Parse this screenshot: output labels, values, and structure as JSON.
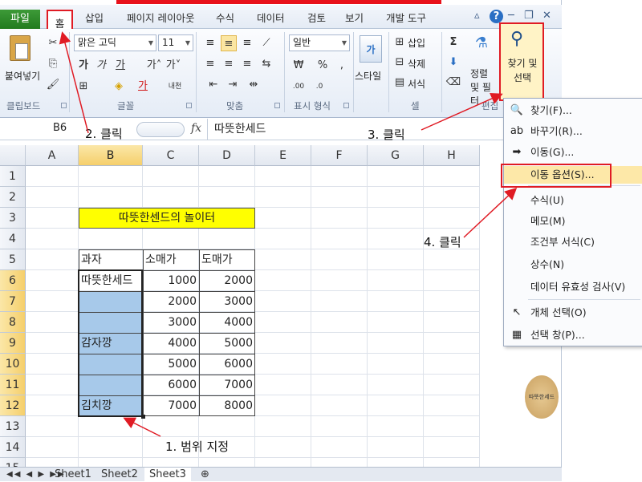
{
  "ribbon_tabs": {
    "file": "파일",
    "home": "홈",
    "insert": "삽입",
    "page_layout": "페이지 레이아웃",
    "formulas": "수식",
    "data": "데이터",
    "review": "검토",
    "view": "보기",
    "developer": "개발 도구"
  },
  "window_controls": {
    "minimize_ribbon": "▵",
    "help": "?",
    "minimize": "─",
    "restore": "❐",
    "close": "✕"
  },
  "ribbon": {
    "paste": "붙여넣기",
    "clipboard_group": "클립보드",
    "font_name": "맑은 고딕",
    "font_size": "11",
    "font_group": "글꼴",
    "align_group": "맞춤",
    "number_format": "일반",
    "number_group": "표시 형식",
    "style": "스타일",
    "insert_cells": "삽입",
    "delete_cells": "삭제",
    "format_cells": "서식",
    "cells_group": "셀",
    "sort_filter": "정렬 및 필터",
    "find_select": "찾기 및 선택",
    "edit_group": "편집"
  },
  "formula_bar": {
    "name_box": "B6",
    "fx": "fx",
    "content": "따뜻한세드"
  },
  "columns": [
    "A",
    "B",
    "C",
    "D",
    "E",
    "F",
    "G",
    "H"
  ],
  "rows": [
    "1",
    "2",
    "3",
    "4",
    "5",
    "6",
    "7",
    "8",
    "9",
    "10",
    "11",
    "12",
    "13",
    "14",
    "15"
  ],
  "sheet": {
    "title": "따뜻한센드의 놀이터",
    "headers": [
      "과자",
      "소매가",
      "도매가"
    ],
    "table_rows": [
      {
        "name": "따뜻한세드",
        "retail": "1000",
        "wholesale": "2000"
      },
      {
        "name": "",
        "retail": "2000",
        "wholesale": "3000"
      },
      {
        "name": "",
        "retail": "3000",
        "wholesale": "4000"
      },
      {
        "name": "감자깡",
        "retail": "4000",
        "wholesale": "5000"
      },
      {
        "name": "",
        "retail": "5000",
        "wholesale": "6000"
      },
      {
        "name": "",
        "retail": "6000",
        "wholesale": "7000"
      },
      {
        "name": "김치깡",
        "retail": "7000",
        "wholesale": "8000"
      }
    ]
  },
  "sheet_tabs": [
    "Sheet1",
    "Sheet2",
    "Sheet3"
  ],
  "find_menu": [
    {
      "label": "찾기(F)...",
      "icon": "binoculars-icon",
      "glyph": "🔍"
    },
    {
      "label": "바꾸기(R)...",
      "icon": "replace-icon",
      "glyph": "ab"
    },
    {
      "label": "이동(G)...",
      "icon": "goto-arrow-icon",
      "glyph": "➡"
    },
    {
      "label": "이동 옵션(S)...",
      "icon": "",
      "glyph": ""
    },
    {
      "label": "수식(U)",
      "icon": "",
      "glyph": ""
    },
    {
      "label": "메모(M)",
      "icon": "",
      "glyph": ""
    },
    {
      "label": "조건부 서식(C)",
      "icon": "",
      "glyph": ""
    },
    {
      "label": "상수(N)",
      "icon": "",
      "glyph": ""
    },
    {
      "label": "데이터 유효성 검사(V)",
      "icon": "",
      "glyph": ""
    },
    {
      "label": "개체 선택(O)",
      "icon": "pointer-icon",
      "glyph": "↖"
    },
    {
      "label": "선택 창(P)...",
      "icon": "selection-pane-icon",
      "glyph": "▦"
    }
  ],
  "annotations": {
    "step1": "1. 범위 지정",
    "step2": "2. 클릭",
    "step3": "3. 클릭",
    "step4": "4. 클릭",
    "stamp": "따뜻한세드"
  },
  "colors": {
    "annotation_red": "#e01b24",
    "title_fill": "#ffff00",
    "selection_fill": "#a7c9ea",
    "file_tab": "#2e8b2a"
  }
}
